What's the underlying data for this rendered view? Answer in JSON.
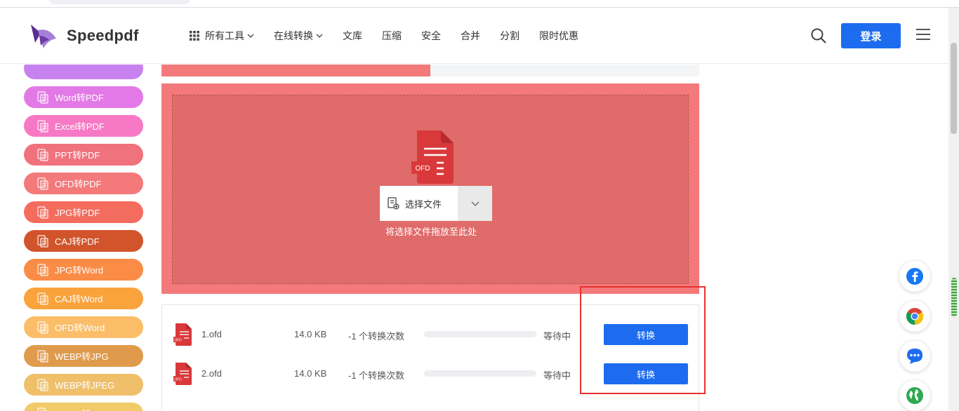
{
  "header": {
    "brand": "Speedpdf",
    "nav": [
      {
        "label": "所有工具",
        "has_dropdown": true,
        "has_grid_icon": true
      },
      {
        "label": "在线转换",
        "has_dropdown": true
      },
      {
        "label": "文库"
      },
      {
        "label": "压缩"
      },
      {
        "label": "安全"
      },
      {
        "label": "合并"
      },
      {
        "label": "分割"
      },
      {
        "label": "限时优惠"
      }
    ],
    "login_label": "登录",
    "search_icon": "search-icon",
    "menu_icon": "hamburger-menu-icon"
  },
  "sidebar": {
    "items": [
      {
        "label": "",
        "color": "#c882f0"
      },
      {
        "label": "Word转PDF",
        "color": "#e379e6"
      },
      {
        "label": "Excel转PDF",
        "color": "#f778c4"
      },
      {
        "label": "PPT转PDF",
        "color": "#f0727d"
      },
      {
        "label": "OFD转PDF",
        "color": "#f4797a"
      },
      {
        "label": "JPG转PDF",
        "color": "#f46c5e"
      },
      {
        "label": "CAJ转PDF",
        "color": "#d2542b"
      },
      {
        "label": "JPG转Word",
        "color": "#fa8c46"
      },
      {
        "label": "CAJ转Word",
        "color": "#faa23c"
      },
      {
        "label": "OFD转Word",
        "color": "#fbbd67"
      },
      {
        "label": "WEBP转JPG",
        "color": "#df9a4b"
      },
      {
        "label": "WEBP转JPEG",
        "color": "#efbf69"
      },
      {
        "label": "WEBP转PNG",
        "color": "#f1cb69"
      }
    ]
  },
  "upload": {
    "file_type_label": "OFD",
    "select_label": "选择文件",
    "drop_hint": "将选择文件拖放至此处",
    "zone_color": "#f4797a"
  },
  "files": [
    {
      "name": "1.ofd",
      "size": "14.0 KB",
      "count": "-1 个转换次数",
      "progress": 0,
      "status": "等待中",
      "action": "转换"
    },
    {
      "name": "2.ofd",
      "size": "14.0 KB",
      "count": "-1 个转换次数",
      "progress": 0,
      "status": "等待中",
      "action": "转换"
    }
  ],
  "floating": [
    "facebook-icon",
    "chrome-icon",
    "chat-icon",
    "globe-icon"
  ],
  "colors": {
    "accent": "#1d6cf0",
    "highlight": "#e8312f"
  }
}
